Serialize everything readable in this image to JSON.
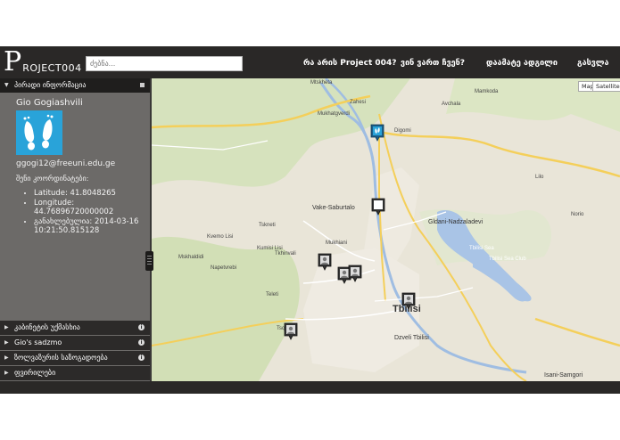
{
  "header": {
    "logo_initial": "P",
    "logo_rest": "ROJECT004",
    "search_placeholder": "ძებნა...",
    "nav": [
      "რა არის Project 004?",
      "ვინ ვართ ჩვენ?",
      "დაამატე ადგილი",
      "გასვლა"
    ]
  },
  "sidebar": {
    "sections": [
      {
        "label": "პირადი ინფორმაცია",
        "expanded": true
      },
      {
        "label": "კაბინეტის უქმასხია",
        "expanded": false
      },
      {
        "label": "Gio's sadzmo",
        "expanded": false
      },
      {
        "label": "ზოლვაზურის საზოგადოება",
        "expanded": false
      },
      {
        "label": "ფვირილები",
        "expanded": false
      }
    ],
    "profile": {
      "name": "Gio Gogiashvili",
      "avatar_icon": "footprints-icon",
      "email": "ggogi12@freeuni.edu.ge",
      "coords_title": "შენი კოორდინატები:",
      "latitude": "Latitude: 41.8048265",
      "longitude": "Longitude: 44.76896720000002",
      "updated": "განახლებულია: 2014-03-16 10:21:50.815128"
    }
  },
  "map": {
    "type_buttons": [
      "Map",
      "Satellite"
    ],
    "labels": [
      "Mtskheta",
      "Zahesi",
      "Mukhatgverdi",
      "Digomi",
      "Avchala",
      "Mamkoda",
      "Vake-Saburtalo",
      "Tskneti",
      "Kumisi Lisi",
      "Tkhinvali",
      "Kvemo Lisi",
      "Mukhiani",
      "Mskhaldidi",
      "Napetvrebi",
      "Gldani-Nadzaladevi",
      "Tbilisi Sea Club",
      "Tbilisi",
      "Dzveli Tbilisi",
      "Isani-Samgori",
      "Tsqneti",
      "Lilo",
      "Norio",
      "Teleti",
      "Tbilisi Sea"
    ],
    "colors": {
      "water": "#a9c4e6",
      "road_major": "#f4cf5a",
      "road": "#ffffff",
      "park": "#c9ddae"
    }
  }
}
